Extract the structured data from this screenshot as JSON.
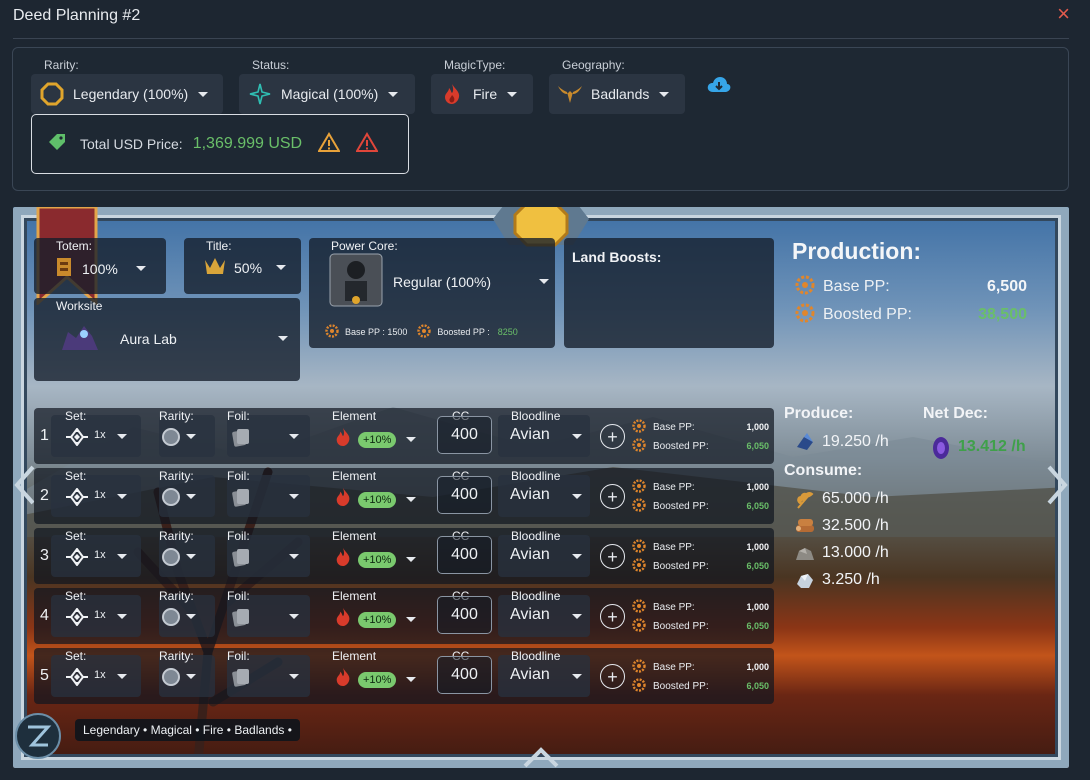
{
  "window": {
    "title": "Deed Planning #2",
    "close_icon": "×"
  },
  "filters": [
    {
      "label": "Rarity:",
      "value": "Legendary (100%)",
      "icon": "octagon-rarity-icon"
    },
    {
      "label": "Status:",
      "value": "Magical (100%)",
      "icon": "magical-star-icon"
    },
    {
      "label": "MagicType:",
      "value": "Fire",
      "icon": "fire-icon"
    },
    {
      "label": "Geography:",
      "value": "Badlands",
      "icon": "badlands-skull-icon"
    }
  ],
  "price": {
    "label": "Total USD Price:",
    "value": "1,369.999 USD"
  },
  "deed": {
    "totem": {
      "label": "Totem:",
      "value": "100%"
    },
    "title": {
      "label": "Title:",
      "value": "50%"
    },
    "worksite": {
      "label": "Worksite",
      "value": "Aura Lab"
    },
    "power_core": {
      "label": "Power Core:",
      "value": "Regular (100%)",
      "base_label": "Base PP : 1500",
      "boosted_label": "Boosted PP :",
      "boosted_value": "8250"
    },
    "land_boosts": {
      "label": "Land Boosts:"
    },
    "tags": "Legendary • Magical • Fire • Badlands •"
  },
  "production": {
    "title": "Production:",
    "base_label": "Base PP:",
    "base_value": "6,500",
    "boosted_label": "Boosted PP:",
    "boosted_value": "38,500"
  },
  "produce": {
    "label": "Produce:",
    "value": "19.250 /h"
  },
  "net_dec": {
    "label": "Net Dec:",
    "value": "13.412 /h"
  },
  "consume": {
    "label": "Consume:",
    "items": [
      {
        "value": "65.000 /h",
        "icon": "grain-icon"
      },
      {
        "value": "32.500 /h",
        "icon": "wood-icon"
      },
      {
        "value": "13.000 /h",
        "icon": "stone-icon"
      },
      {
        "value": "3.250 /h",
        "icon": "iron-icon"
      }
    ]
  },
  "row_labels": {
    "set": "Set:",
    "rarity": "Rarity:",
    "foil": "Foil:",
    "element": "Element",
    "cc": "CC",
    "bloodline": "Bloodline",
    "base_pp": "Base PP:",
    "boosted_pp": "Boosted PP:"
  },
  "rows": [
    {
      "num": "1",
      "set": "1x",
      "boost": "+10%",
      "cc": "400",
      "bloodline": "Avian",
      "base": "1,000",
      "boosted": "6,050"
    },
    {
      "num": "2",
      "set": "1x",
      "boost": "+10%",
      "cc": "400",
      "bloodline": "Avian",
      "base": "1,000",
      "boosted": "6,050"
    },
    {
      "num": "3",
      "set": "1x",
      "boost": "+10%",
      "cc": "400",
      "bloodline": "Avian",
      "base": "1,000",
      "boosted": "6,050"
    },
    {
      "num": "4",
      "set": "1x",
      "boost": "+10%",
      "cc": "400",
      "bloodline": "Avian",
      "base": "1,000",
      "boosted": "6,050"
    },
    {
      "num": "5",
      "set": "1x",
      "boost": "+10%",
      "cc": "400",
      "bloodline": "Avian",
      "base": "1,000",
      "boosted": "6,050"
    }
  ],
  "colors": {
    "green": "#6abf69",
    "warning_orange": "#e8a23a",
    "warning_red": "#e0463a",
    "accent_blue": "#36a5e8"
  }
}
